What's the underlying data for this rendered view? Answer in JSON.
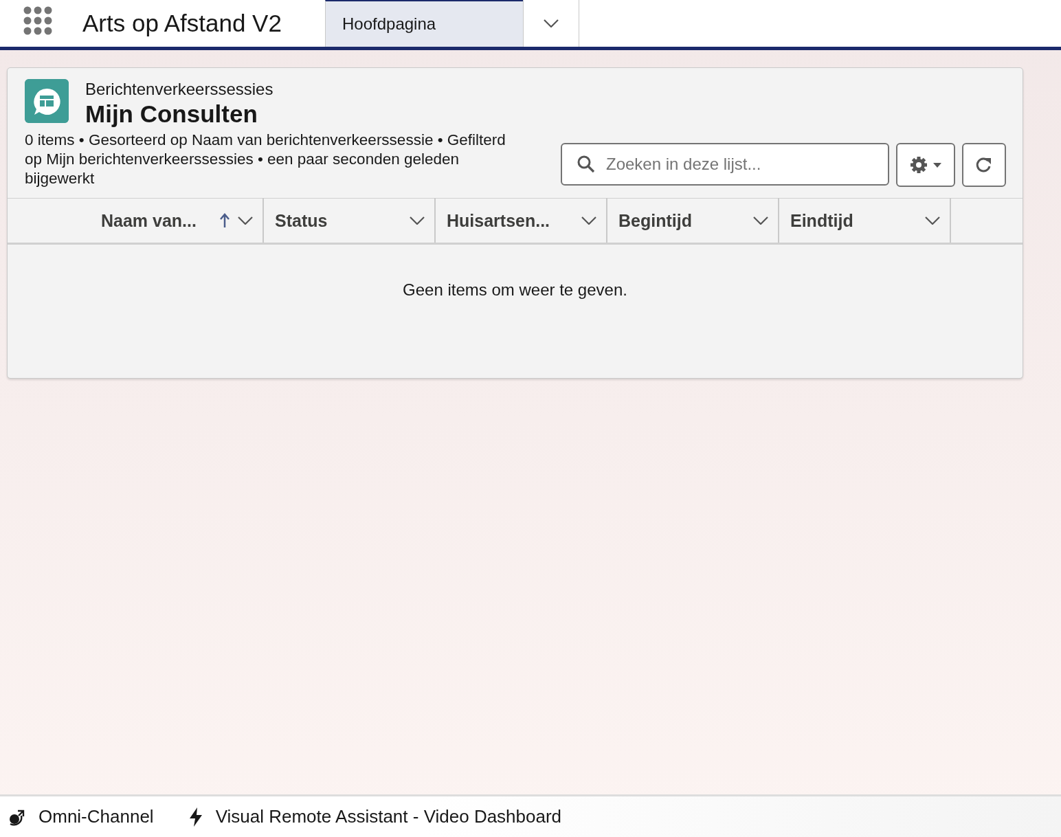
{
  "app": {
    "name": "Arts op Afstand V2"
  },
  "tabs": [
    {
      "label": "Hoofdpagina",
      "selected": true
    }
  ],
  "list_view": {
    "object": "Berichtenverkeerssessies",
    "title": "Mijn Consulten",
    "summary": "0 items • Gesorteerd op Naam van berichtenverkeerssessie • Gefilterd op Mijn berichtenverkeerssessies • een paar seconden geleden bijgewerkt",
    "search": {
      "placeholder": "Zoeken in deze lijst..."
    },
    "columns": [
      {
        "label": "Naam van...",
        "sorted": true
      },
      {
        "label": "Status",
        "sorted": false
      },
      {
        "label": "Huisartsen...",
        "sorted": false
      },
      {
        "label": "Begintijd",
        "sorted": false
      },
      {
        "label": "Eindtijd",
        "sorted": false
      }
    ],
    "empty_message": "Geen items om weer te geven."
  },
  "utility_bar": [
    {
      "label": "Omni-Channel",
      "kind": "omni"
    },
    {
      "label": "Visual Remote Assistant - Video Dashboard",
      "kind": "bolt"
    }
  ]
}
